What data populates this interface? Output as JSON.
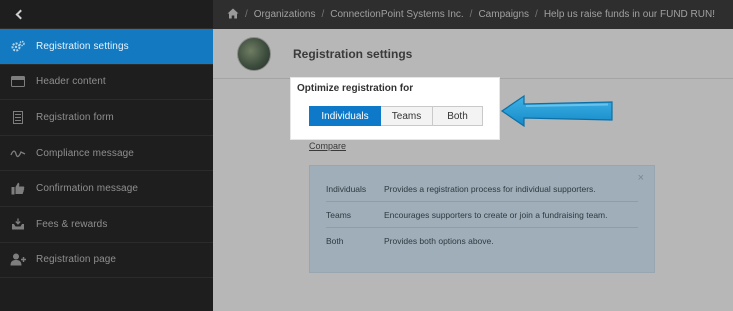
{
  "sidebar": {
    "items": [
      {
        "label": "Registration settings",
        "icon": "gears-icon",
        "active": true
      },
      {
        "label": "Header content",
        "icon": "header-icon",
        "active": false
      },
      {
        "label": "Registration form",
        "icon": "form-icon",
        "active": false
      },
      {
        "label": "Compliance message",
        "icon": "signature-icon",
        "active": false
      },
      {
        "label": "Confirmation message",
        "icon": "thumbs-up-icon",
        "active": false
      },
      {
        "label": "Fees & rewards",
        "icon": "inbox-icon",
        "active": false
      },
      {
        "label": "Registration page",
        "icon": "add-user-icon",
        "active": false
      }
    ]
  },
  "breadcrumb": {
    "items": [
      "Organizations",
      "ConnectionPoint Systems Inc.",
      "Campaigns",
      "Help us raise funds in our FUND RUN!"
    ]
  },
  "header": {
    "title": "Registration settings"
  },
  "optimize": {
    "title": "Optimize registration for",
    "options": [
      "Individuals",
      "Teams",
      "Both"
    ],
    "selected": "Individuals"
  },
  "compare": {
    "label": "Compare"
  },
  "info": {
    "close": "×",
    "rows": [
      {
        "term": "Individuals",
        "desc": "Provides a registration process for individual supporters."
      },
      {
        "term": "Teams",
        "desc": "Encourages supporters to create or join a fundraising team."
      },
      {
        "term": "Both",
        "desc": "Provides both options above."
      }
    ]
  },
  "colors": {
    "accent": "#137ac1",
    "selected": "#0d79c8",
    "arrow": "#1a9ad6"
  }
}
